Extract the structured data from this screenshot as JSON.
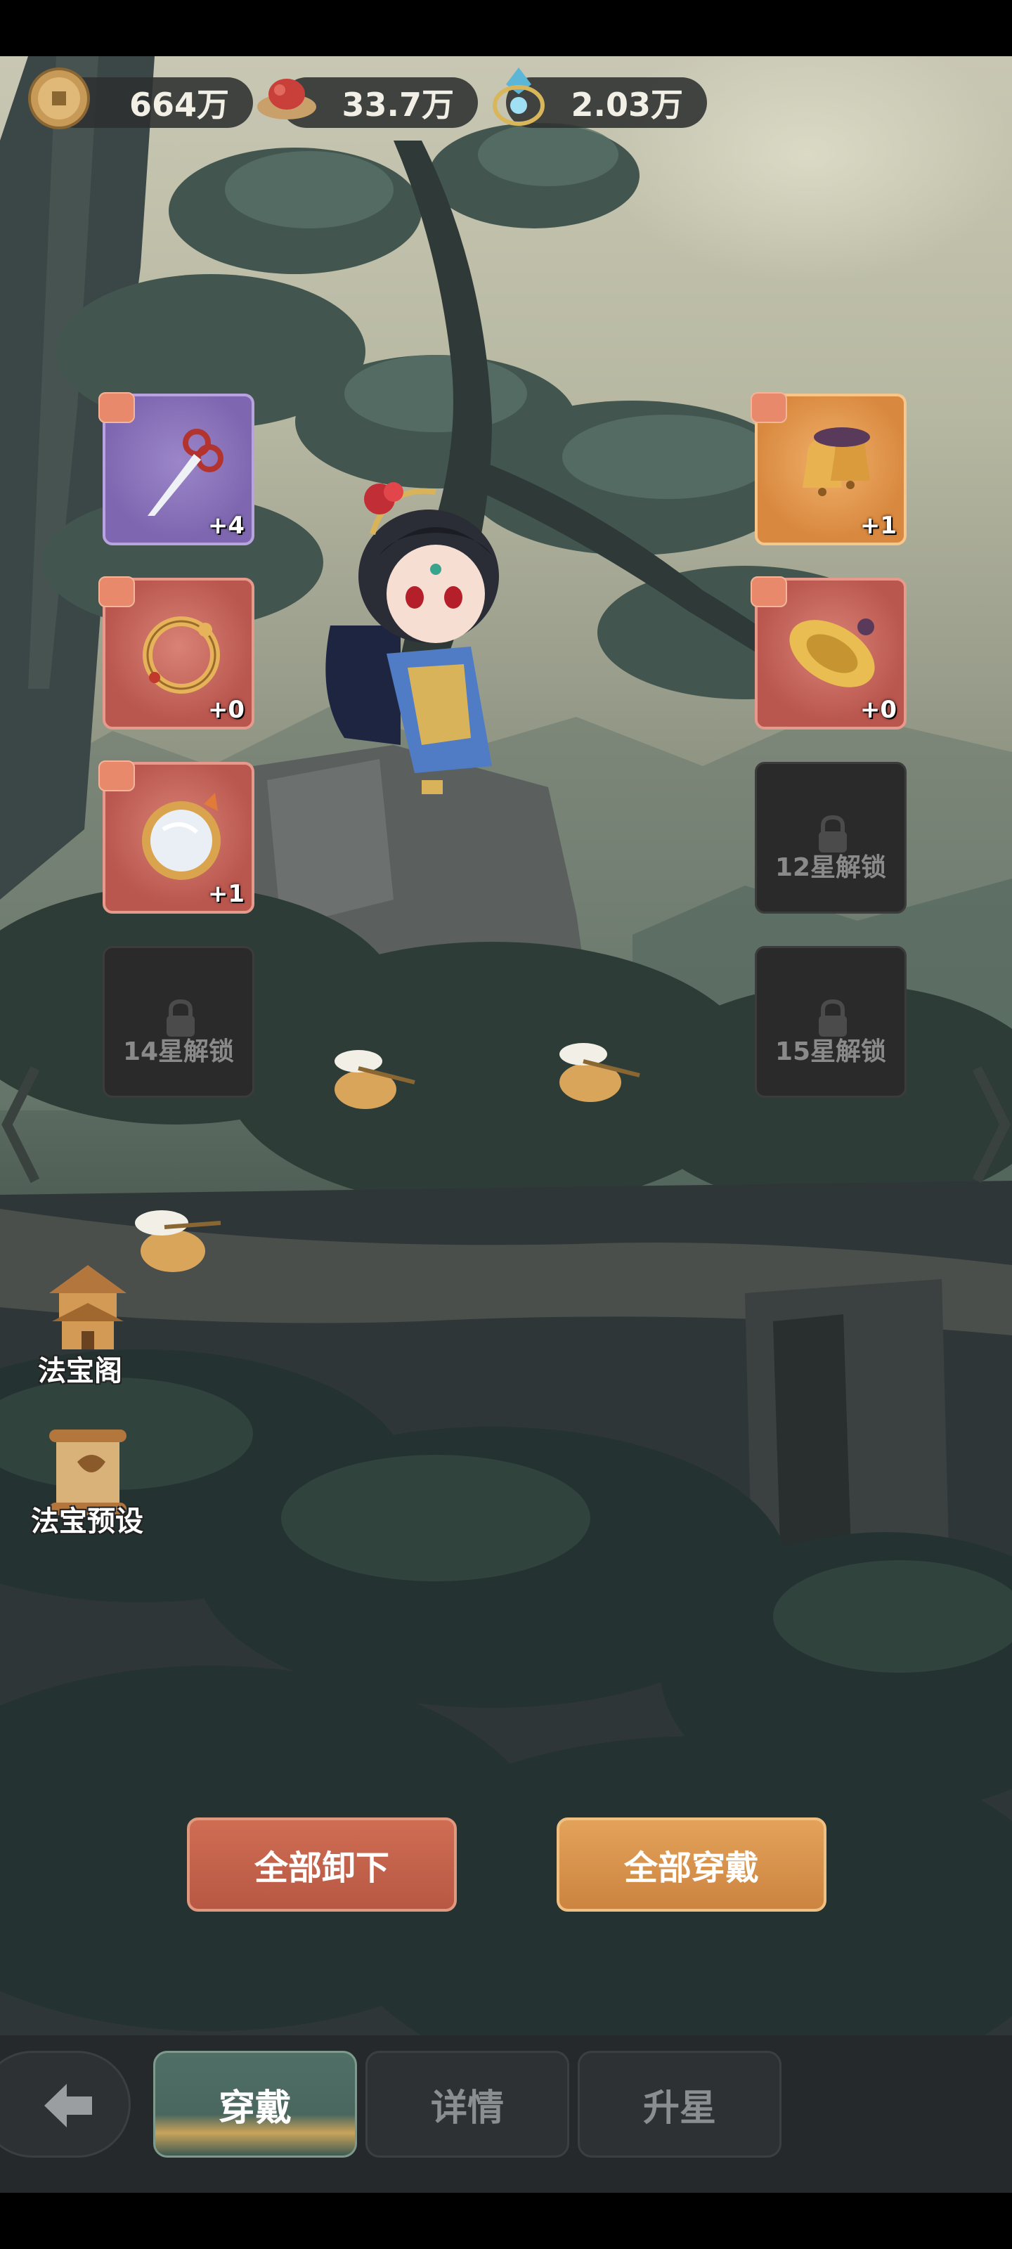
{
  "currencies": [
    {
      "icon": "copper-coin-icon",
      "value": "664万"
    },
    {
      "icon": "red-gourd-icon",
      "value": "33.7万"
    },
    {
      "icon": "blue-crystal-icon",
      "value": "2.03万"
    }
  ],
  "left_slots": [
    {
      "item": "scissors-icon",
      "rarity": "purple",
      "level": "+4"
    },
    {
      "item": "dragon-bracelet-icon",
      "rarity": "red",
      "level": "+0"
    },
    {
      "item": "mirror-icon",
      "rarity": "red",
      "level": "+1"
    },
    {
      "locked": true,
      "lock_text": "14星解锁"
    }
  ],
  "right_slots": [
    {
      "item": "bells-icon",
      "rarity": "orange",
      "level": "+1"
    },
    {
      "item": "cymbal-icon",
      "rarity": "red",
      "level": "+0"
    },
    {
      "locked": true,
      "lock_text": "12星解锁"
    },
    {
      "locked": true,
      "lock_text": "15星解锁"
    }
  ],
  "side_menu": {
    "pavilion_label": "法宝阁",
    "preset_label": "法宝预设"
  },
  "actions": {
    "unequip_all": "全部卸下",
    "equip_all": "全部穿戴"
  },
  "tabs": [
    {
      "label": "穿戴",
      "active": true
    },
    {
      "label": "详情",
      "active": false
    },
    {
      "label": "升星",
      "active": false
    }
  ],
  "colors": {
    "purple_rarity": "#7e67b0",
    "red_rarity": "#b9564e",
    "orange_rarity": "#d9893f",
    "unequip_button": "#c4624b",
    "equip_button": "#d8934d"
  }
}
